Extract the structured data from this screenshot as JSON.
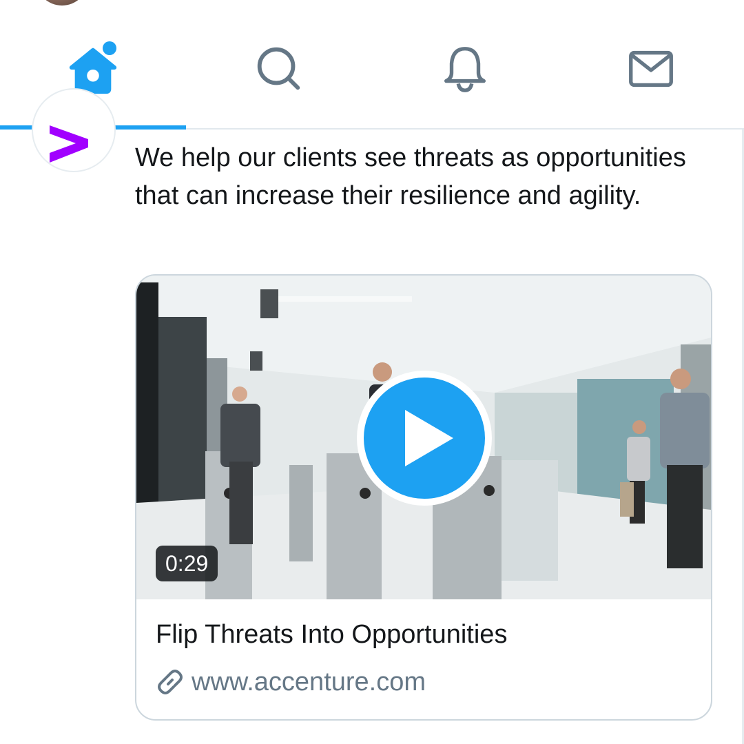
{
  "nav": {
    "tabs": [
      {
        "name": "home",
        "icon": "home-icon",
        "active": true,
        "has_notification_dot": true
      },
      {
        "name": "search",
        "icon": "search-icon",
        "active": false
      },
      {
        "name": "notifications",
        "icon": "bell-icon",
        "active": false
      },
      {
        "name": "messages",
        "icon": "mail-icon",
        "active": false
      }
    ],
    "accent_color": "#1da1f2",
    "inactive_icon_color": "#657786"
  },
  "tweet": {
    "author_avatar_icon": "accenture-logo-icon",
    "text": "We help our clients see threats as opportunities that can increase their resilience and agility.",
    "card": {
      "media_icon": "video-thumbnail",
      "duration": "0:29",
      "title": "Flip Threats Into Opportunities",
      "link_icon": "link-icon",
      "link_text": "www.accenture.com"
    }
  }
}
